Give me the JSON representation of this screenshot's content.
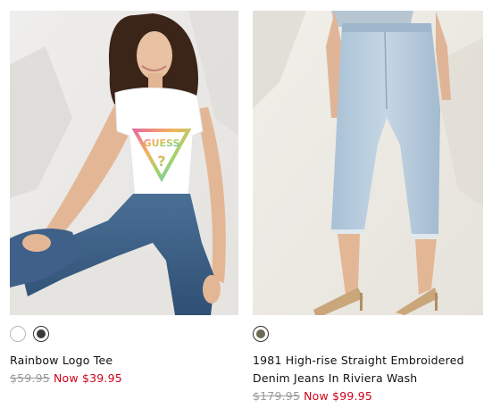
{
  "products": [
    {
      "name": "Rainbow Logo Tee",
      "price_original": "$59.95",
      "price_now": "Now $39.95",
      "swatch_colors": [
        "#ffffff",
        "#3a3a3a"
      ],
      "selected_swatch": 1,
      "image_icon": "model-in-rainbow-logo-tee-photo",
      "logo_text": "GUESS"
    },
    {
      "name": "1981 High-rise Straight Embroidered Denim Jeans In Riviera Wash",
      "price_original": "$179.95",
      "price_now": "Now $99.95",
      "swatch_colors": [
        "#6b6a55"
      ],
      "selected_swatch": 0,
      "image_icon": "model-in-light-denim-jeans-photo"
    }
  ],
  "colors": {
    "sale": "#d0021b",
    "original_price": "#9a9a9a",
    "text": "#111111"
  }
}
